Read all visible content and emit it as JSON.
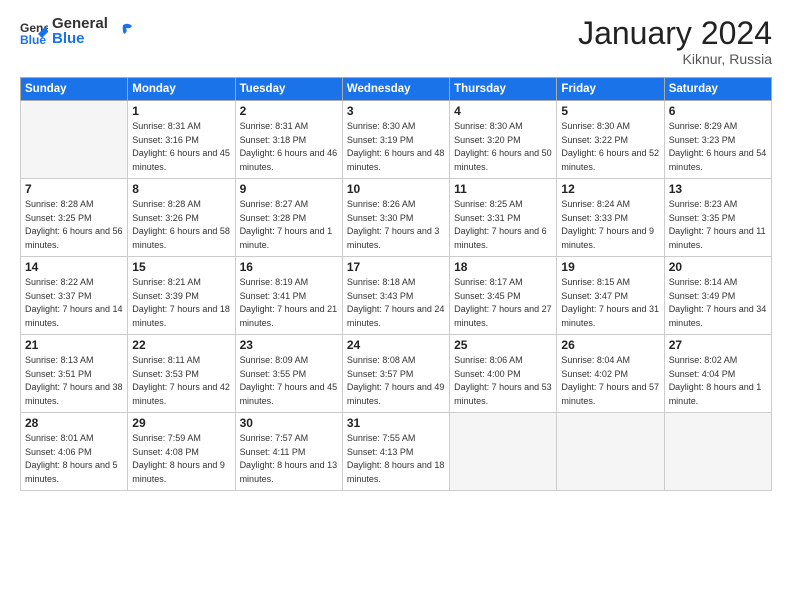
{
  "logo": {
    "general": "General",
    "blue": "Blue"
  },
  "header": {
    "month": "January 2024",
    "location": "Kiknur, Russia"
  },
  "weekdays": [
    "Sunday",
    "Monday",
    "Tuesday",
    "Wednesday",
    "Thursday",
    "Friday",
    "Saturday"
  ],
  "weeks": [
    [
      {
        "day": "",
        "sunrise": "",
        "sunset": "",
        "daylight": "",
        "empty": true
      },
      {
        "day": "1",
        "sunrise": "Sunrise: 8:31 AM",
        "sunset": "Sunset: 3:16 PM",
        "daylight": "Daylight: 6 hours and 45 minutes."
      },
      {
        "day": "2",
        "sunrise": "Sunrise: 8:31 AM",
        "sunset": "Sunset: 3:18 PM",
        "daylight": "Daylight: 6 hours and 46 minutes."
      },
      {
        "day": "3",
        "sunrise": "Sunrise: 8:30 AM",
        "sunset": "Sunset: 3:19 PM",
        "daylight": "Daylight: 6 hours and 48 minutes."
      },
      {
        "day": "4",
        "sunrise": "Sunrise: 8:30 AM",
        "sunset": "Sunset: 3:20 PM",
        "daylight": "Daylight: 6 hours and 50 minutes."
      },
      {
        "day": "5",
        "sunrise": "Sunrise: 8:30 AM",
        "sunset": "Sunset: 3:22 PM",
        "daylight": "Daylight: 6 hours and 52 minutes."
      },
      {
        "day": "6",
        "sunrise": "Sunrise: 8:29 AM",
        "sunset": "Sunset: 3:23 PM",
        "daylight": "Daylight: 6 hours and 54 minutes."
      }
    ],
    [
      {
        "day": "7",
        "sunrise": "Sunrise: 8:28 AM",
        "sunset": "Sunset: 3:25 PM",
        "daylight": "Daylight: 6 hours and 56 minutes."
      },
      {
        "day": "8",
        "sunrise": "Sunrise: 8:28 AM",
        "sunset": "Sunset: 3:26 PM",
        "daylight": "Daylight: 6 hours and 58 minutes."
      },
      {
        "day": "9",
        "sunrise": "Sunrise: 8:27 AM",
        "sunset": "Sunset: 3:28 PM",
        "daylight": "Daylight: 7 hours and 1 minute."
      },
      {
        "day": "10",
        "sunrise": "Sunrise: 8:26 AM",
        "sunset": "Sunset: 3:30 PM",
        "daylight": "Daylight: 7 hours and 3 minutes."
      },
      {
        "day": "11",
        "sunrise": "Sunrise: 8:25 AM",
        "sunset": "Sunset: 3:31 PM",
        "daylight": "Daylight: 7 hours and 6 minutes."
      },
      {
        "day": "12",
        "sunrise": "Sunrise: 8:24 AM",
        "sunset": "Sunset: 3:33 PM",
        "daylight": "Daylight: 7 hours and 9 minutes."
      },
      {
        "day": "13",
        "sunrise": "Sunrise: 8:23 AM",
        "sunset": "Sunset: 3:35 PM",
        "daylight": "Daylight: 7 hours and 11 minutes."
      }
    ],
    [
      {
        "day": "14",
        "sunrise": "Sunrise: 8:22 AM",
        "sunset": "Sunset: 3:37 PM",
        "daylight": "Daylight: 7 hours and 14 minutes."
      },
      {
        "day": "15",
        "sunrise": "Sunrise: 8:21 AM",
        "sunset": "Sunset: 3:39 PM",
        "daylight": "Daylight: 7 hours and 18 minutes."
      },
      {
        "day": "16",
        "sunrise": "Sunrise: 8:19 AM",
        "sunset": "Sunset: 3:41 PM",
        "daylight": "Daylight: 7 hours and 21 minutes."
      },
      {
        "day": "17",
        "sunrise": "Sunrise: 8:18 AM",
        "sunset": "Sunset: 3:43 PM",
        "daylight": "Daylight: 7 hours and 24 minutes."
      },
      {
        "day": "18",
        "sunrise": "Sunrise: 8:17 AM",
        "sunset": "Sunset: 3:45 PM",
        "daylight": "Daylight: 7 hours and 27 minutes."
      },
      {
        "day": "19",
        "sunrise": "Sunrise: 8:15 AM",
        "sunset": "Sunset: 3:47 PM",
        "daylight": "Daylight: 7 hours and 31 minutes."
      },
      {
        "day": "20",
        "sunrise": "Sunrise: 8:14 AM",
        "sunset": "Sunset: 3:49 PM",
        "daylight": "Daylight: 7 hours and 34 minutes."
      }
    ],
    [
      {
        "day": "21",
        "sunrise": "Sunrise: 8:13 AM",
        "sunset": "Sunset: 3:51 PM",
        "daylight": "Daylight: 7 hours and 38 minutes."
      },
      {
        "day": "22",
        "sunrise": "Sunrise: 8:11 AM",
        "sunset": "Sunset: 3:53 PM",
        "daylight": "Daylight: 7 hours and 42 minutes."
      },
      {
        "day": "23",
        "sunrise": "Sunrise: 8:09 AM",
        "sunset": "Sunset: 3:55 PM",
        "daylight": "Daylight: 7 hours and 45 minutes."
      },
      {
        "day": "24",
        "sunrise": "Sunrise: 8:08 AM",
        "sunset": "Sunset: 3:57 PM",
        "daylight": "Daylight: 7 hours and 49 minutes."
      },
      {
        "day": "25",
        "sunrise": "Sunrise: 8:06 AM",
        "sunset": "Sunset: 4:00 PM",
        "daylight": "Daylight: 7 hours and 53 minutes."
      },
      {
        "day": "26",
        "sunrise": "Sunrise: 8:04 AM",
        "sunset": "Sunset: 4:02 PM",
        "daylight": "Daylight: 7 hours and 57 minutes."
      },
      {
        "day": "27",
        "sunrise": "Sunrise: 8:02 AM",
        "sunset": "Sunset: 4:04 PM",
        "daylight": "Daylight: 8 hours and 1 minute."
      }
    ],
    [
      {
        "day": "28",
        "sunrise": "Sunrise: 8:01 AM",
        "sunset": "Sunset: 4:06 PM",
        "daylight": "Daylight: 8 hours and 5 minutes."
      },
      {
        "day": "29",
        "sunrise": "Sunrise: 7:59 AM",
        "sunset": "Sunset: 4:08 PM",
        "daylight": "Daylight: 8 hours and 9 minutes."
      },
      {
        "day": "30",
        "sunrise": "Sunrise: 7:57 AM",
        "sunset": "Sunset: 4:11 PM",
        "daylight": "Daylight: 8 hours and 13 minutes."
      },
      {
        "day": "31",
        "sunrise": "Sunrise: 7:55 AM",
        "sunset": "Sunset: 4:13 PM",
        "daylight": "Daylight: 8 hours and 18 minutes."
      },
      {
        "day": "",
        "sunrise": "",
        "sunset": "",
        "daylight": "",
        "empty": true
      },
      {
        "day": "",
        "sunrise": "",
        "sunset": "",
        "daylight": "",
        "empty": true
      },
      {
        "day": "",
        "sunrise": "",
        "sunset": "",
        "daylight": "",
        "empty": true
      }
    ]
  ]
}
